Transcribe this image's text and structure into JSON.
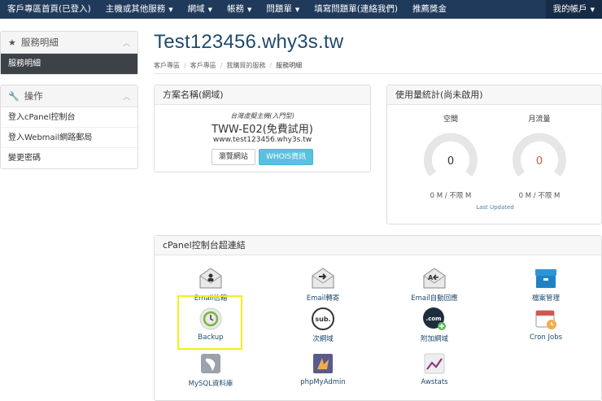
{
  "topnav": {
    "items": [
      "客戶專區首頁(已登入)",
      "主機或其他服務",
      "網域",
      "帳務",
      "問題單",
      "填寫問題單(連絡我們)",
      "推薦獎金"
    ],
    "account": "我的帳戶"
  },
  "sidebar": {
    "service_title": "服務明細",
    "service_active": "服務明細",
    "ops_title": "操作",
    "ops_links": [
      "登入cPanel控制台",
      "登入Webmail網路郵局",
      "變更密碼"
    ]
  },
  "page": {
    "title": "Test123456.why3s.tw",
    "breadcrumb": [
      "客戶專區",
      "客戶專區",
      "我購買的服務",
      "服務明細"
    ]
  },
  "plan": {
    "heading": "方案名稱(網域)",
    "logo_text": "台灣虛擬主機(入門型)",
    "name": "TWW-E02(免費試用)",
    "domain": "www.test123456.why3s.tw",
    "browse_label": "瀏覽網站",
    "whois_label": "WHOIS資訊"
  },
  "usage": {
    "heading": "使用量統計(尚未啟用)",
    "disk": {
      "label": "空間",
      "value": "0",
      "footer": "0 M / 不限 M"
    },
    "traffic": {
      "label": "月流量",
      "value": "0",
      "footer": "0 M / 不限 M"
    },
    "last_updated": "Last Updated"
  },
  "cpanel": {
    "heading": "cPanel控制台超連結",
    "icons": [
      "Email信箱",
      "Email轉寄",
      "Email自動回應",
      "檔案管理",
      "Backup",
      "次網域",
      "附加網域",
      "Cron Jobs",
      "MySQL資料庫",
      "phpMyAdmin",
      "Awstats"
    ]
  },
  "colors": {
    "nav": "#1f3a5a",
    "accent": "#1f4a6e",
    "info": "#5bc0de",
    "traffic_value": "#d9534f",
    "highlight": "#f2ef1e"
  }
}
